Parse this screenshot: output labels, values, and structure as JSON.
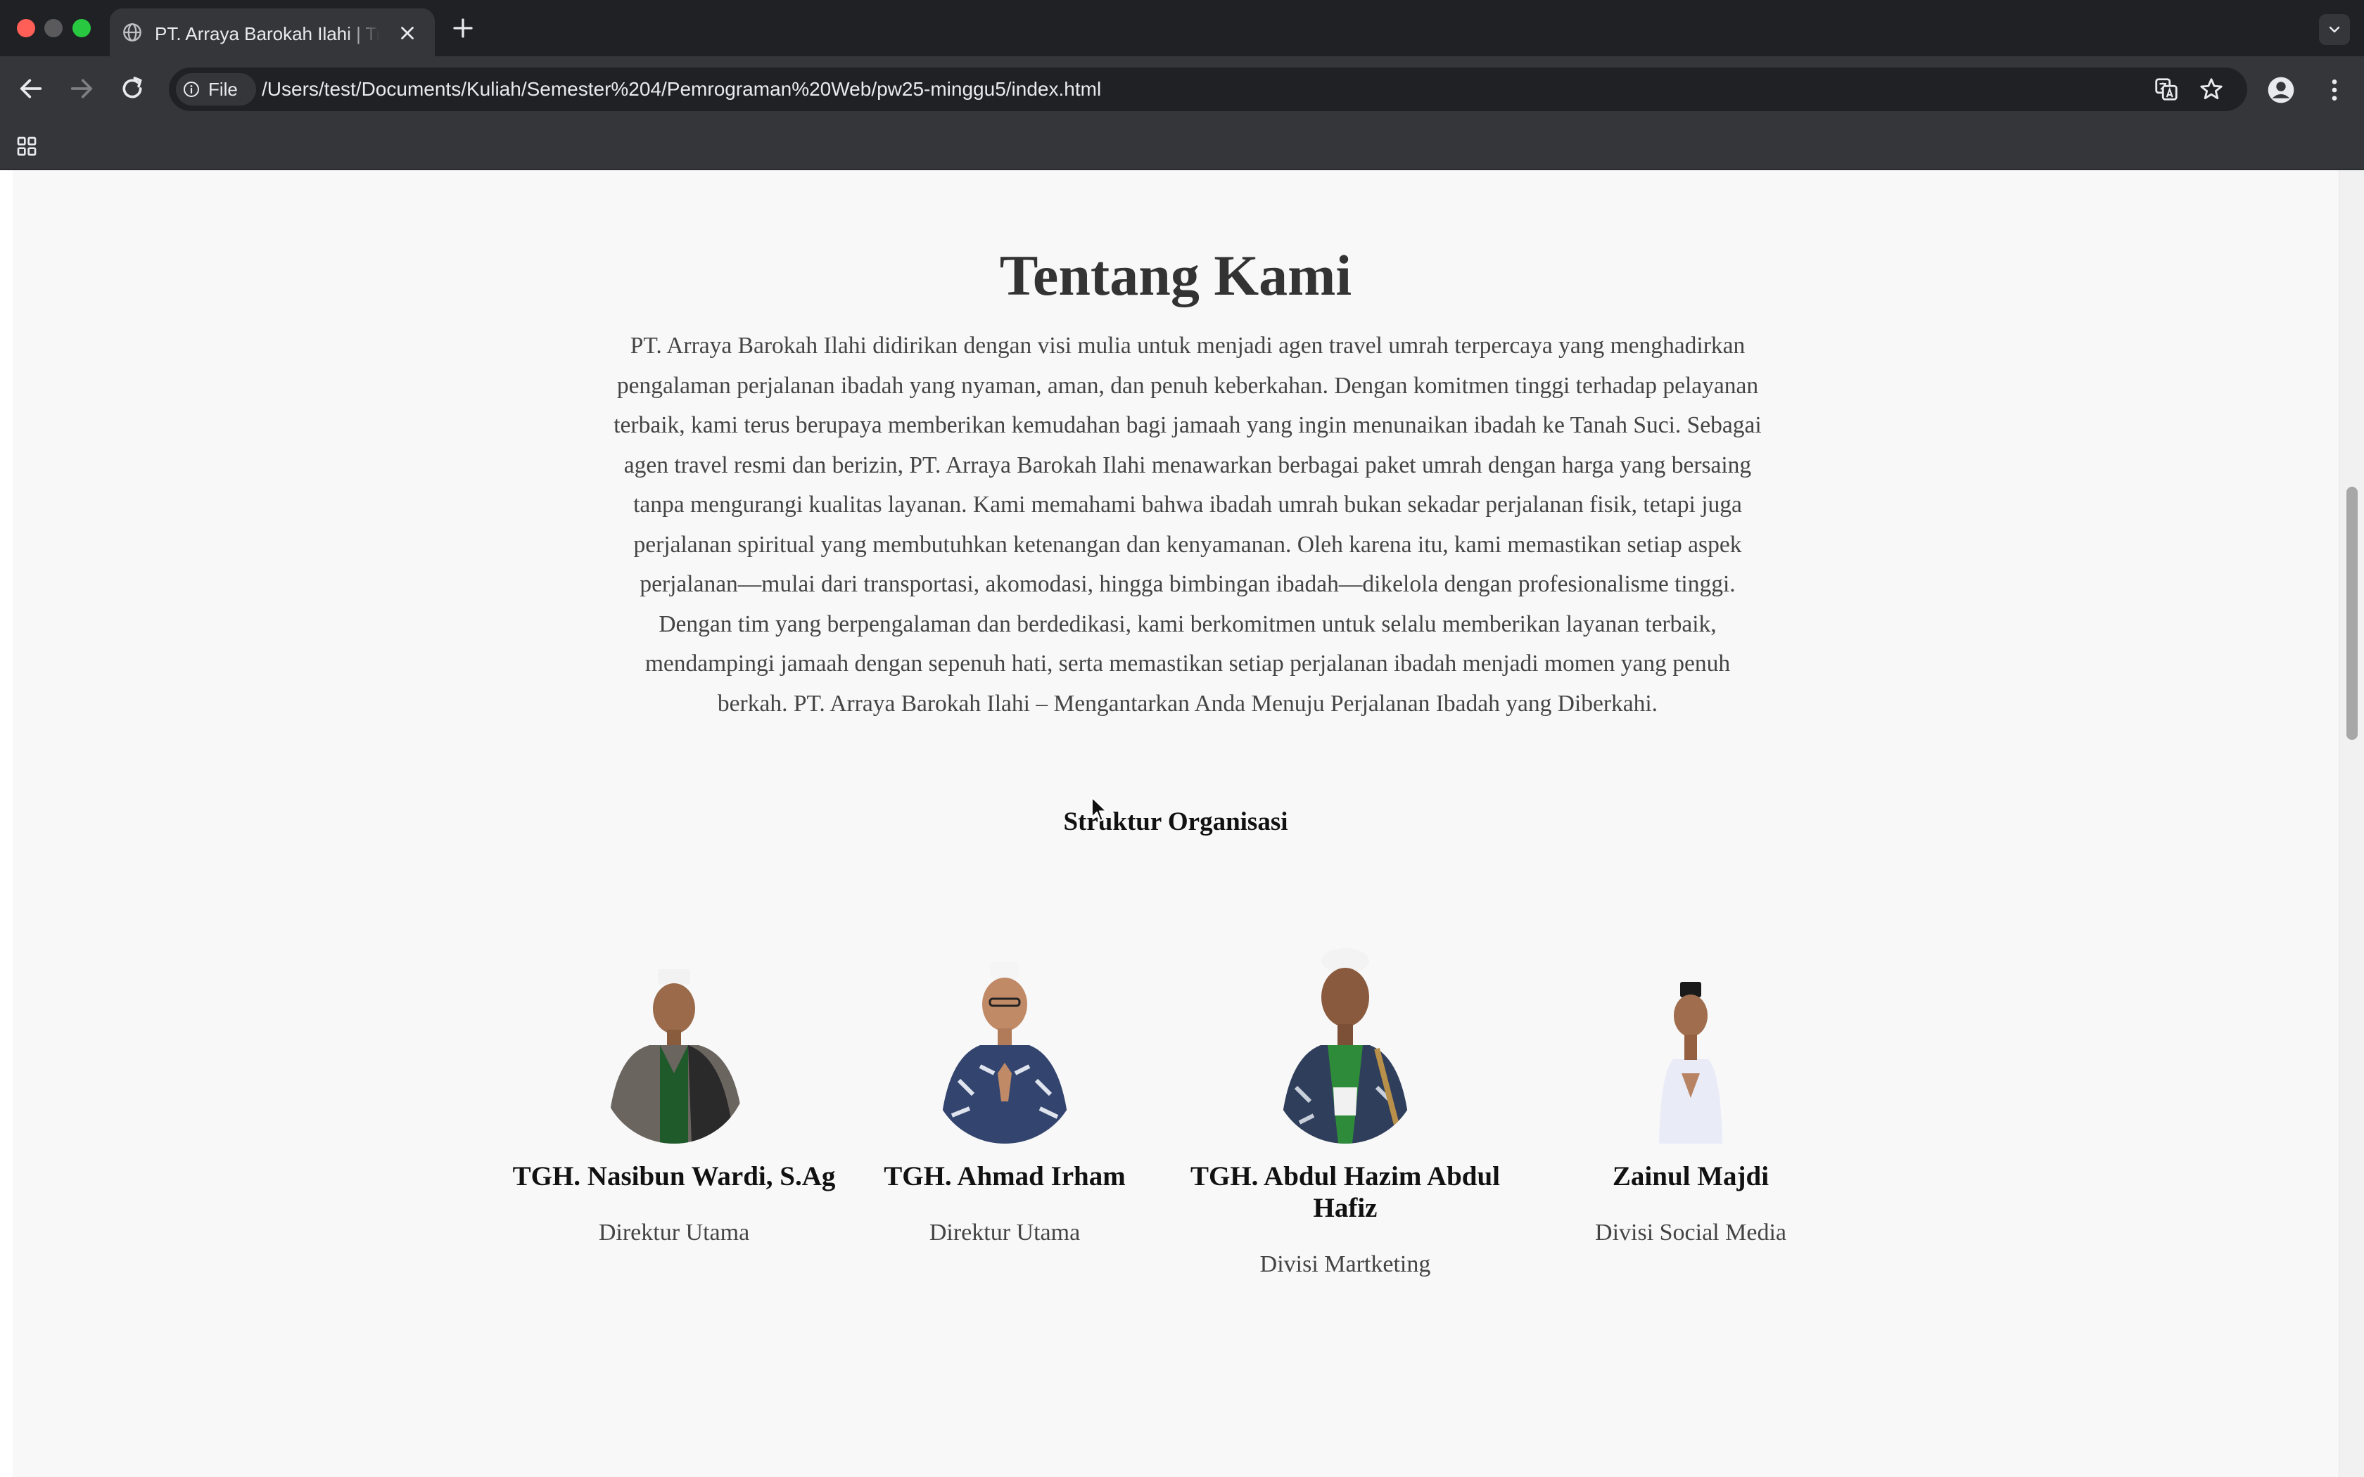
{
  "browser": {
    "tab_title": "PT. Arraya Barokah Ilahi | Travel Umrah",
    "file_chip": "File",
    "url": "/Users/test/Documents/Kuliah/Semester%204/Pemrograman%20Web/pw25-minggu5/index.html"
  },
  "about": {
    "title": "Tentang Kami",
    "text": "PT. Arraya Barokah Ilahi didirikan dengan visi mulia untuk menjadi agen travel umrah terpercaya yang menghadirkan pengalaman perjalanan ibadah yang nyaman, aman, dan penuh keberkahan. Dengan komitmen tinggi terhadap pelayanan terbaik, kami terus berupaya memberikan kemudahan bagi jamaah yang ingin menunaikan ibadah ke Tanah Suci. Sebagai agen travel resmi dan berizin, PT. Arraya Barokah Ilahi menawarkan berbagai paket umrah dengan harga yang bersaing tanpa mengurangi kualitas layanan. Kami memahami bahwa ibadah umrah bukan sekadar perjalanan fisik, tetapi juga perjalanan spiritual yang membutuhkan ketenangan dan kenyamanan. Oleh karena itu, kami memastikan setiap aspek perjalanan—mulai dari transportasi, akomodasi, hingga bimbingan ibadah—dikelola dengan profesionalisme tinggi. Dengan tim yang berpengalaman dan berdedikasi, kami berkomitmen untuk selalu memberikan layanan terbaik, mendampingi jamaah dengan sepenuh hati, serta memastikan setiap perjalanan ibadah menjadi momen yang penuh berkah. PT. Arraya Barokah Ilahi – Mengantarkan Anda Menuju Perjalanan Ibadah yang Diberkahi."
  },
  "organization": {
    "title": "Struktur Organisasi",
    "members": [
      {
        "name": "TGH. Nasibun Wardi, S.Ag",
        "role": "Direktur Utama"
      },
      {
        "name": "TGH. Ahmad Irham",
        "role": "Direktur Utama"
      },
      {
        "name": "TGH. Abdul Hazim Abdul Hafiz",
        "role": "Divisi Martketing"
      },
      {
        "name": "Zainul Majdi",
        "role": "Divisi Social Media"
      }
    ]
  },
  "icons": {
    "tab_favicon": "globe-icon",
    "tab_close": "close-icon",
    "new_tab": "plus-icon",
    "tab_search": "chevron-down-icon",
    "back": "back-arrow-icon",
    "forward": "forward-arrow-icon",
    "reload": "reload-icon",
    "site_info": "info-icon",
    "translate": "translate-icon",
    "bookmark": "star-icon",
    "profile": "profile-icon",
    "menu": "more-vert-icon",
    "apps": "apps-grid-icon"
  }
}
